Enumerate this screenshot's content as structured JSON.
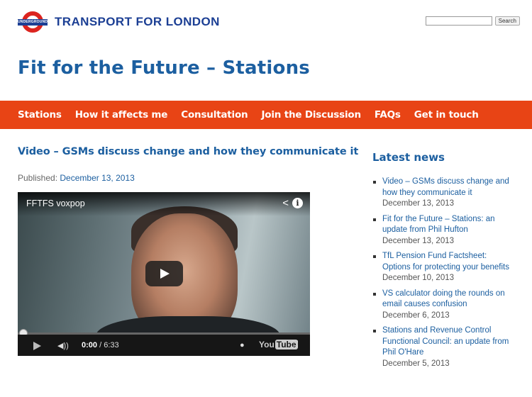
{
  "header": {
    "roundel_text": "UNDERGROUND",
    "brand_name": "TRANSPORT FOR LONDON",
    "search_button": "Search",
    "search_value": ""
  },
  "page_title": "Fit for the Future – Stations",
  "nav": [
    "Stations",
    "How it affects me",
    "Consultation",
    "Join the Discussion",
    "FAQs",
    "Get in touch"
  ],
  "article": {
    "title": "Video – GSMs discuss change and how they communicate it",
    "published_label": "Published:",
    "published_date": "December 13, 2013"
  },
  "video": {
    "title": "FFTFS voxpop",
    "current_time": "0:00",
    "duration": "/ 6:33",
    "progress": 0,
    "brand": "You",
    "brand_box": "Tube"
  },
  "sidebar": {
    "title": "Latest news",
    "items": [
      {
        "title": "Video – GSMs discuss change and how they communicate it",
        "date": "December 13, 2013"
      },
      {
        "title": "Fit for the Future – Stations: an update from Phil Hufton",
        "date": "December 13, 2013"
      },
      {
        "title": "TfL Pension Fund Factsheet: Options for protecting your benefits",
        "date": "December 10, 2013"
      },
      {
        "title": "VS calculator doing the rounds on email causes confusion",
        "date": "December 6, 2013"
      },
      {
        "title": "Stations and Revenue Control Functional Council: an update from Phil O'Hare",
        "date": "December 5, 2013"
      }
    ]
  },
  "colors": {
    "brand_blue": "#1c3f94",
    "link_blue": "#1c5fa0",
    "nav_orange": "#e84415",
    "roundel_red": "#dc241f"
  }
}
